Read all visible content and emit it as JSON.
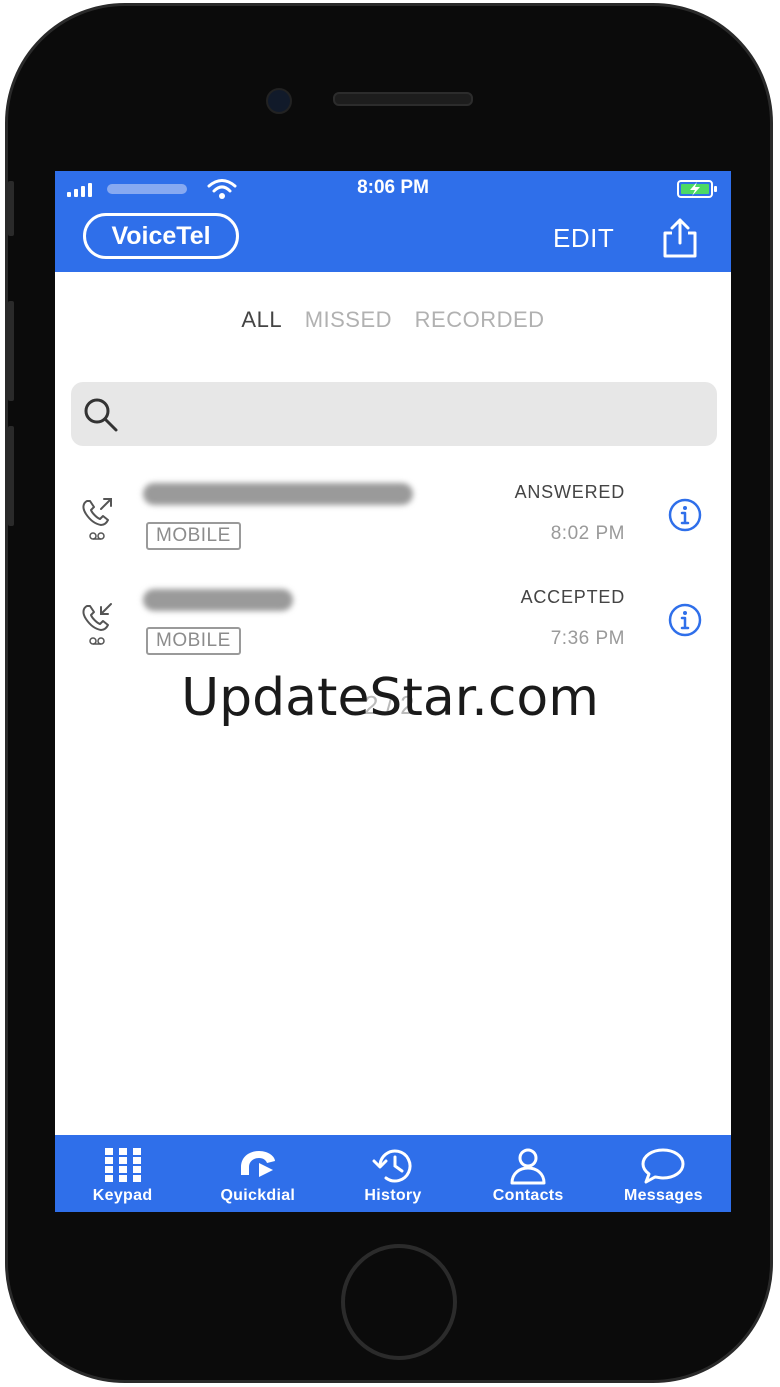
{
  "status_bar": {
    "time": "8:06 PM"
  },
  "header": {
    "logo": "VoiceTel",
    "edit_label": "EDIT",
    "accent": "#2f6fea"
  },
  "tabs": [
    {
      "label": "ALL",
      "active": true
    },
    {
      "label": "MISSED",
      "active": false
    },
    {
      "label": "RECORDED",
      "active": false
    }
  ],
  "search": {
    "placeholder": "",
    "value": ""
  },
  "calls": [
    {
      "direction_icon": "outgoing-call-icon",
      "type": "MOBILE",
      "status": "ANSWERED",
      "time": "8:02 PM"
    },
    {
      "direction_icon": "incoming-call-icon",
      "type": "MOBILE",
      "status": "ACCEPTED",
      "time": "7:36 PM"
    }
  ],
  "watermark": "UpdateStar.com",
  "watermark_faint": "2 / 2",
  "nav": [
    {
      "label": "Keypad",
      "icon": "keypad-icon"
    },
    {
      "label": "Quickdial",
      "icon": "quickdial-icon"
    },
    {
      "label": "History",
      "icon": "history-icon"
    },
    {
      "label": "Contacts",
      "icon": "contacts-icon"
    },
    {
      "label": "Messages",
      "icon": "messages-icon"
    }
  ]
}
